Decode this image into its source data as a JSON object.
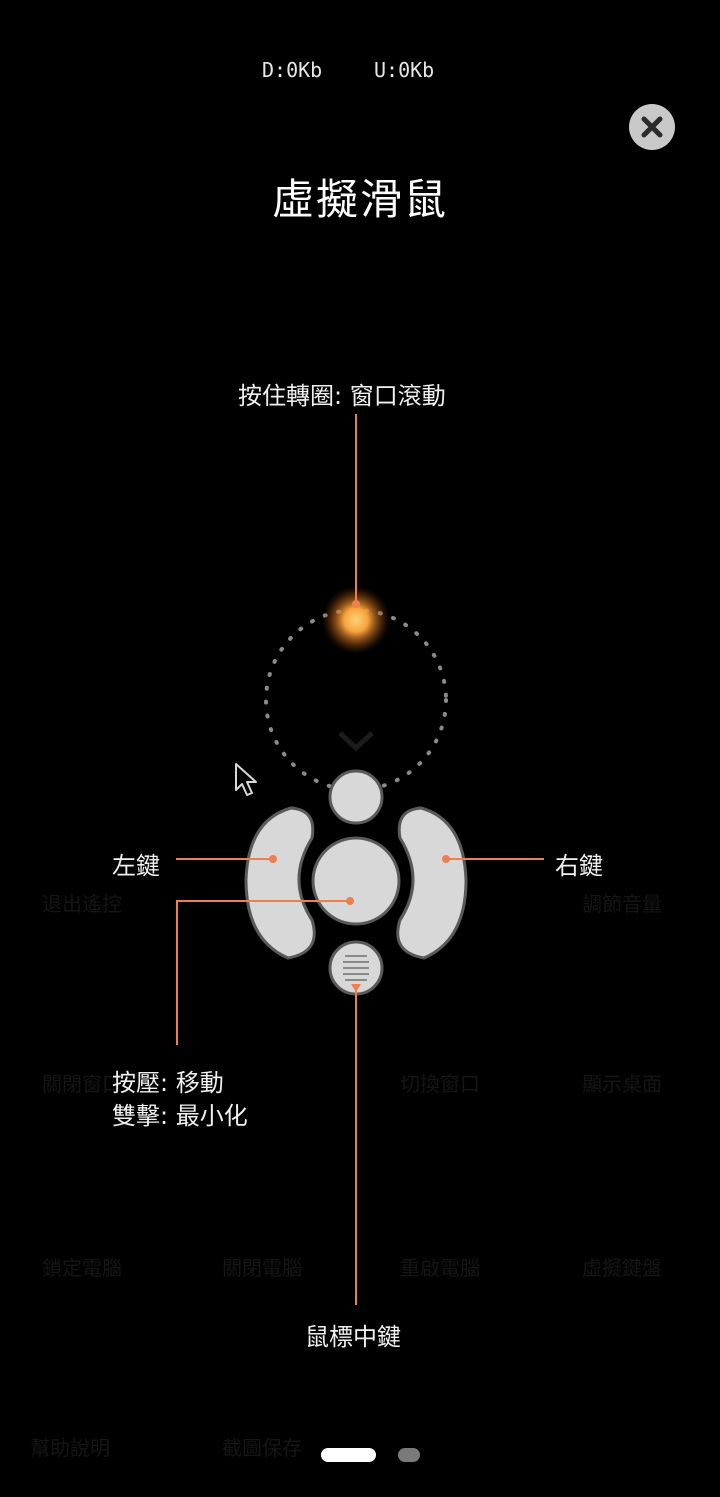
{
  "status": {
    "download": "D:0Kb",
    "upload": "U:0Kb"
  },
  "title": "虛擬滑鼠",
  "labels": {
    "scroll": "按住轉圈: 窗口滾動",
    "left": "左鍵",
    "right": "右鍵",
    "press": "按壓: 移動",
    "double": "雙擊: 最小化",
    "middle": "鼠標中鍵"
  },
  "background_tiles": [
    "退出遙控",
    "調節音量",
    "關閉窗口",
    "切換窗口",
    "顯示桌面",
    "鎖定電腦",
    "關閉電腦",
    "重啟電腦",
    "虛擬鍵盤",
    "幫助說明",
    "截圖保存"
  ],
  "page_indicator": {
    "pages": 2,
    "active": 1
  },
  "colors": {
    "accent": "#ee7f4f",
    "background": "#000000",
    "mouse_body": "#d8d8d8",
    "close_button": "#c9c9c9"
  },
  "icons": {
    "close": "close-icon",
    "cursor": "cursor-arrow-icon"
  }
}
